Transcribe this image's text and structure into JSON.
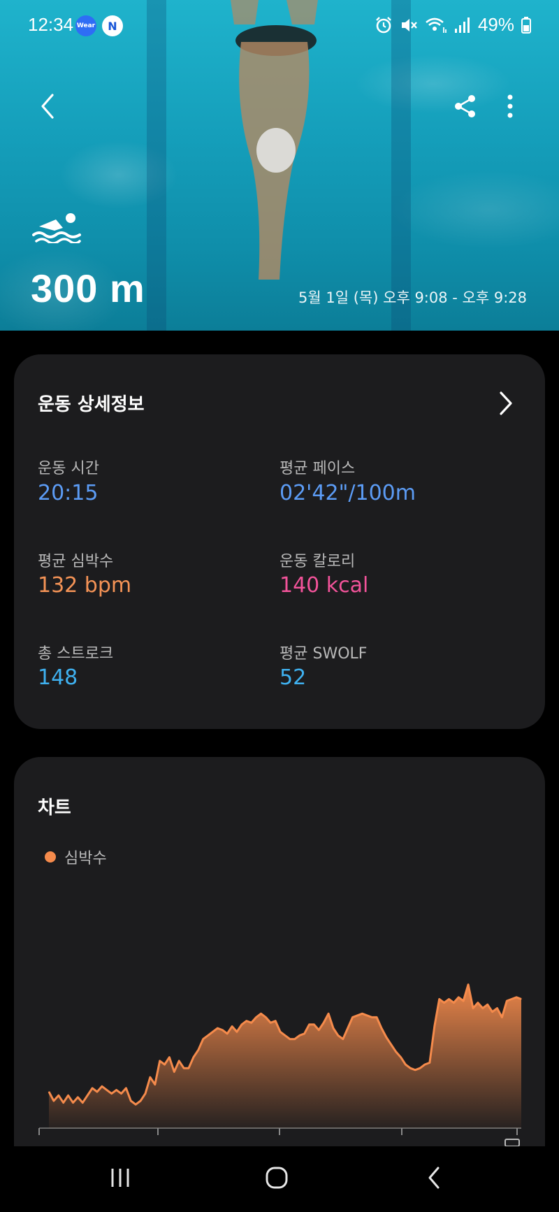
{
  "status_bar": {
    "time": "12:34",
    "wear_badge": "Wear",
    "n_badge": "N",
    "battery": "49%",
    "icons": [
      "alarm-icon",
      "mute-icon",
      "wifi-icon",
      "signal-icon",
      "battery-icon"
    ]
  },
  "hero": {
    "activity_icon": "swimming-icon",
    "distance": "300 m",
    "session_time": "5월 1일 (목) 오후 9:08 - 오후 9:28"
  },
  "details": {
    "title": "운동 상세정보",
    "stats": [
      {
        "label": "운동 시간",
        "value": "20:15",
        "color": "#5c9cf5"
      },
      {
        "label": "평균 페이스",
        "value": "02'42\"/100m",
        "color": "#5c9cf5"
      },
      {
        "label": "평균 심박수",
        "value": "132 bpm",
        "color": "#f49356"
      },
      {
        "label": "운동 칼로리",
        "value": "140 kcal",
        "color": "#f2539a"
      },
      {
        "label": "총 스트로크",
        "value": "148",
        "color": "#3fb1f0"
      },
      {
        "label": "평균 SWOLF",
        "value": "52",
        "color": "#3fb1f0"
      }
    ]
  },
  "chart": {
    "title": "차트",
    "legend": "심박수",
    "accent": "#f58b4c"
  },
  "chart_data": {
    "type": "area",
    "series": [
      {
        "name": "심박수",
        "values": [
          105,
          100,
          103,
          99,
          103,
          99,
          102,
          99,
          103,
          107,
          105,
          108,
          106,
          104,
          106,
          104,
          107,
          100,
          98,
          100,
          104,
          113,
          109,
          122,
          120,
          124,
          116,
          122,
          118,
          118,
          124,
          128,
          134,
          136,
          138,
          140,
          139,
          137,
          141,
          138,
          142,
          144,
          143,
          146,
          148,
          146,
          143,
          144,
          138,
          136,
          134,
          134,
          136,
          137,
          142,
          142,
          139,
          143,
          148,
          140,
          136,
          134,
          140,
          146,
          147,
          148,
          147,
          146,
          146,
          140,
          135,
          131,
          127,
          124,
          120,
          118,
          117,
          118,
          120,
          121,
          141,
          156,
          154,
          156,
          154,
          157,
          155,
          164,
          151,
          154,
          151,
          153,
          149,
          151,
          146,
          155,
          156,
          157,
          156
        ]
      }
    ],
    "ylim": [
      85,
      175
    ]
  },
  "bottom_nav": {
    "icons": [
      "recents-icon",
      "home-icon",
      "back-icon"
    ]
  }
}
